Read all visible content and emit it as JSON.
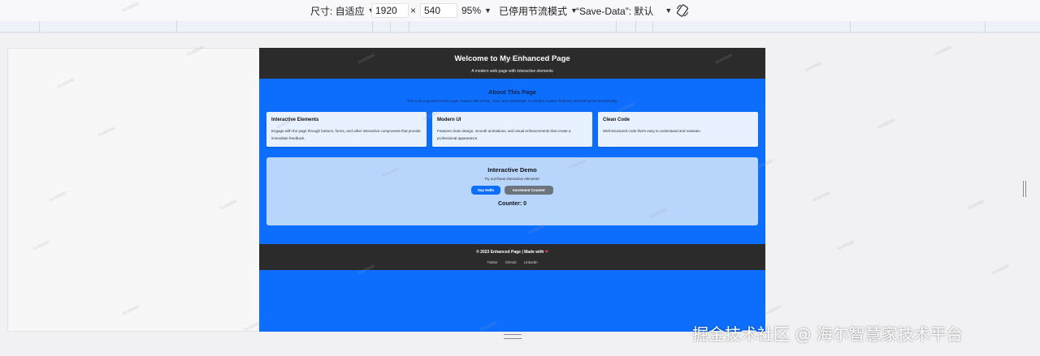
{
  "toolbar": {
    "size_label": "尺寸: 自适应",
    "width": "1920",
    "times": "×",
    "height": "540",
    "zoom": "95%",
    "throttle": "已停用节流模式",
    "save_data": "“Save-Data”: 默认",
    "rotate_icon": "rotate-icon"
  },
  "site": {
    "title": "Welcome to My Enhanced Page",
    "tagline": "A modern web page with interactive elements",
    "about_title": "About This Page",
    "about_text": "This is an improved HTML page created with HTML, CSS, and JavaScript. It includes modern features and interactive functionality.",
    "cards": [
      {
        "title": "Interactive Elements",
        "text": "Engage with the page through buttons, forms, and other interactive components that provide immediate feedback."
      },
      {
        "title": "Modern UI",
        "text": "Features clean design, smooth animations, and visual enhancements that create a professional appearance."
      },
      {
        "title": "Clean Code",
        "text": "Well-structured code that's easy to understand and maintain."
      }
    ],
    "demo_title": "Interactive Demo",
    "demo_sub": "Try out these interactive elements:",
    "btn_hello": "Say Hello",
    "btn_increment": "Increment Counter",
    "counter": "Counter: 0",
    "footer_copy": "© 2023 Enhanced Page | Made with",
    "footer_heart": "❤",
    "footer_links": [
      "Twitter",
      "GitHub",
      "LinkedIn"
    ]
  },
  "watermark": {
    "text": "掘金技术社区 @ 海尔智慧家技术平台",
    "id": "01450000"
  },
  "colors": {
    "page_bg": "#0d6efd",
    "header_bg": "#2b2b2b",
    "card_bg": "#e7f1ff",
    "demo_bg": "#b8d5fb",
    "btn_primary": "#0d6efd",
    "btn_secondary": "#6c757d"
  }
}
